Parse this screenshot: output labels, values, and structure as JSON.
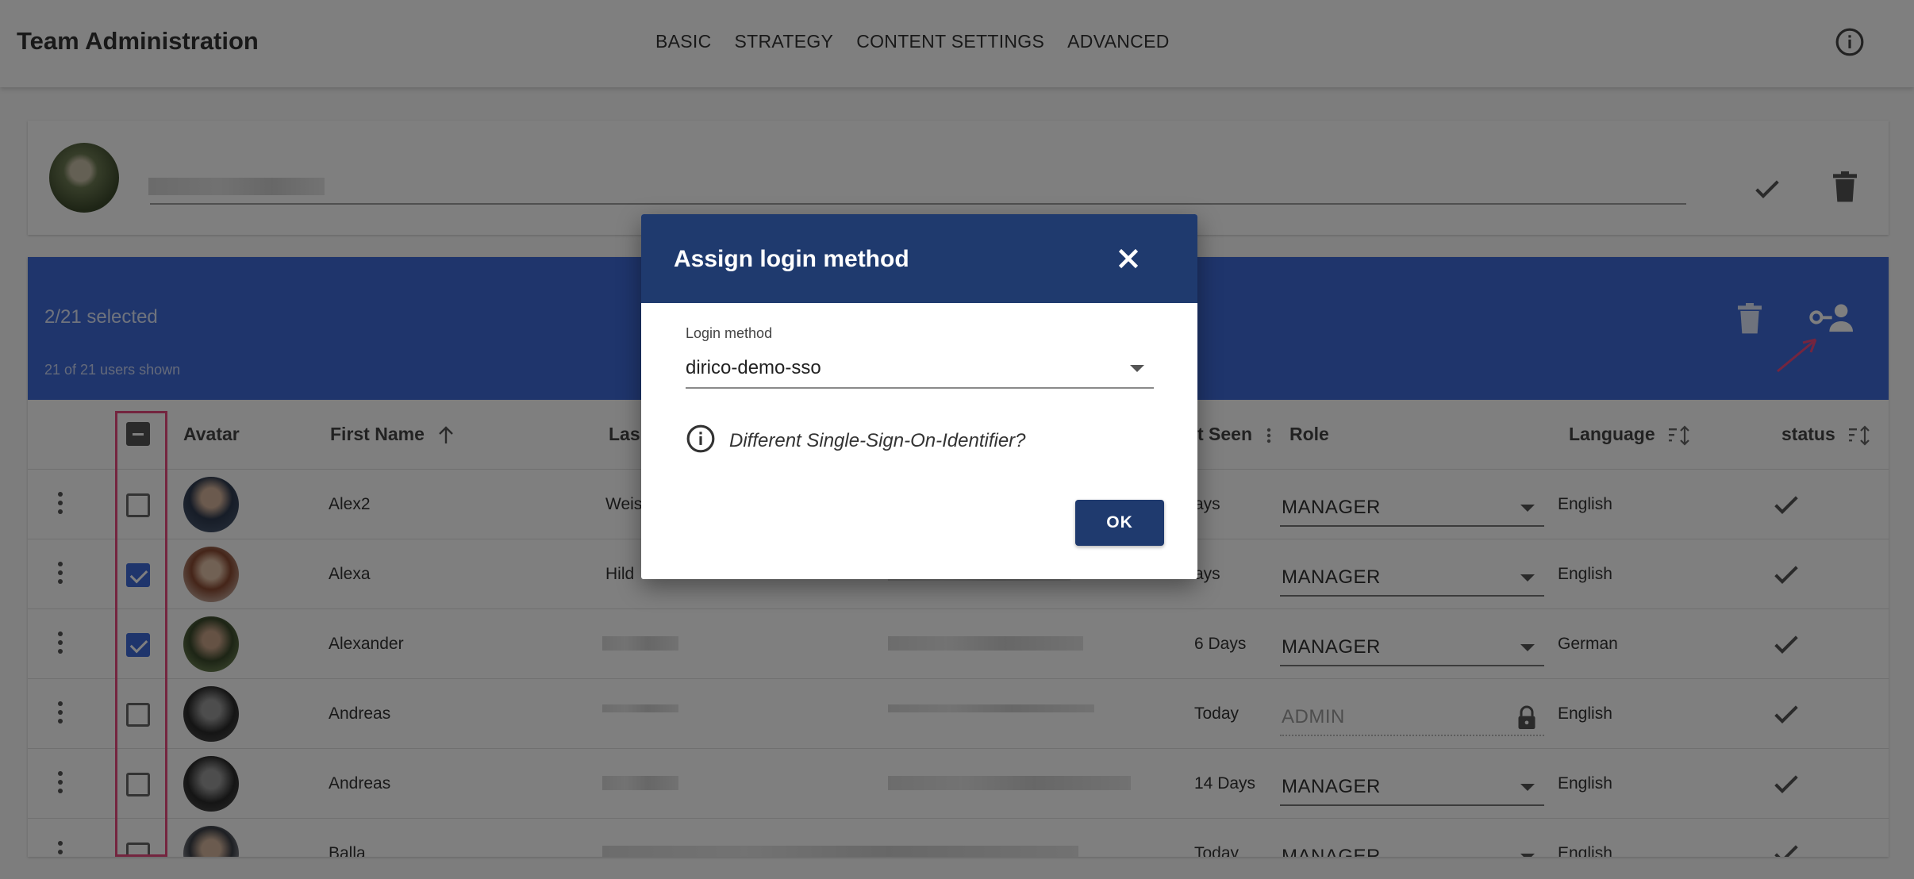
{
  "app": {
    "title": "Team Administration"
  },
  "nav": {
    "items": [
      "BASIC",
      "STRATEGY",
      "CONTENT SETTINGS",
      "ADVANCED"
    ]
  },
  "selection": {
    "count": "2/21 selected",
    "shown": "21 of 21 users shown"
  },
  "table": {
    "columns": {
      "avatar": "Avatar",
      "first_name": "First Name",
      "last_name": "Las",
      "last_seen": "t Seen",
      "role": "Role",
      "language": "Language",
      "status": "status"
    },
    "rows": [
      {
        "first_name": "Alex2",
        "last_name": "Weis",
        "email": "",
        "last_seen": "ays",
        "role": "MANAGER",
        "language": "English",
        "checked": false
      },
      {
        "first_name": "Alexa",
        "last_name": "Hild",
        "email": "",
        "last_seen": "ays",
        "role": "MANAGER",
        "language": "English",
        "checked": true
      },
      {
        "first_name": "Alexander",
        "last_name": "",
        "email": "",
        "last_seen": "6 Days",
        "role": "MANAGER",
        "language": "German",
        "checked": true
      },
      {
        "first_name": "Andreas",
        "last_name": "",
        "email": "",
        "last_seen": "Today",
        "role": "ADMIN",
        "language": "English",
        "checked": false
      },
      {
        "first_name": "Andreas",
        "last_name": "",
        "email": "",
        "last_seen": "14 Days",
        "role": "MANAGER",
        "language": "English",
        "checked": false
      },
      {
        "first_name": "Balla",
        "last_name": "",
        "email": "",
        "last_seen": "Today",
        "role": "MANAGER",
        "language": "English",
        "checked": false
      }
    ]
  },
  "dialog": {
    "title": "Assign login method",
    "field_label": "Login method",
    "field_value": "dirico-demo-sso",
    "sso_text": "Different Single-Sign-On-Identifier?",
    "ok_label": "OK"
  },
  "colors": {
    "primary": "#1f3a6e",
    "selection_bar": "#3f6ad8",
    "highlight": "#e84a7f"
  }
}
